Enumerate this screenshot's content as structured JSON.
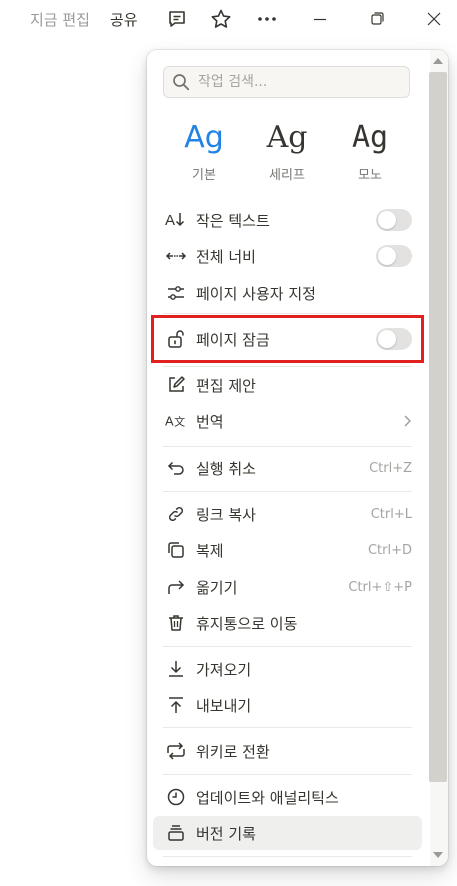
{
  "topbar": {
    "edit_status": "지금 편집",
    "share": "공유",
    "icons": [
      "comment-icon",
      "star-icon",
      "more-icon",
      "minimize-icon",
      "restore-icon",
      "close-icon"
    ]
  },
  "menu": {
    "search_placeholder": "작업 검색...",
    "fonts": [
      {
        "sample": "Ag",
        "label": "기본",
        "selected": true,
        "color": "#2383e2"
      },
      {
        "sample": "Ag",
        "label": "세리프",
        "selected": false
      },
      {
        "sample": "Ag",
        "label": "모노",
        "selected": false
      }
    ],
    "items": [
      {
        "label": "작은 텍스트",
        "icon": "small-text-icon",
        "toggle": false
      },
      {
        "label": "전체 너비",
        "icon": "full-width-icon",
        "toggle": false
      },
      {
        "label": "페이지 사용자 지정",
        "icon": "customize-icon"
      },
      {
        "label": "페이지 잠금",
        "icon": "lock-icon",
        "toggle": false
      },
      {
        "label": "편집 제안",
        "icon": "suggest-edit-icon"
      },
      {
        "label": "번역",
        "icon": "translate-icon",
        "submenu": true
      },
      {
        "label": "실행 취소",
        "icon": "undo-icon",
        "shortcut": "Ctrl+Z"
      },
      {
        "label": "링크 복사",
        "icon": "link-icon",
        "shortcut": "Ctrl+L"
      },
      {
        "label": "복제",
        "icon": "duplicate-icon",
        "shortcut": "Ctrl+D"
      },
      {
        "label": "옮기기",
        "icon": "move-icon",
        "shortcut": "Ctrl+⇧+P"
      },
      {
        "label": "휴지통으로 이동",
        "icon": "trash-icon"
      },
      {
        "label": "가져오기",
        "icon": "import-icon"
      },
      {
        "label": "내보내기",
        "icon": "export-icon"
      },
      {
        "label": "위키로 전환",
        "icon": "wiki-icon"
      },
      {
        "label": "업데이트와 애널리틱스",
        "icon": "clock-icon"
      },
      {
        "label": "버전 기록",
        "icon": "version-history-icon"
      }
    ]
  },
  "colors": {
    "highlight": "#e1201f",
    "accent": "#2383e2"
  }
}
